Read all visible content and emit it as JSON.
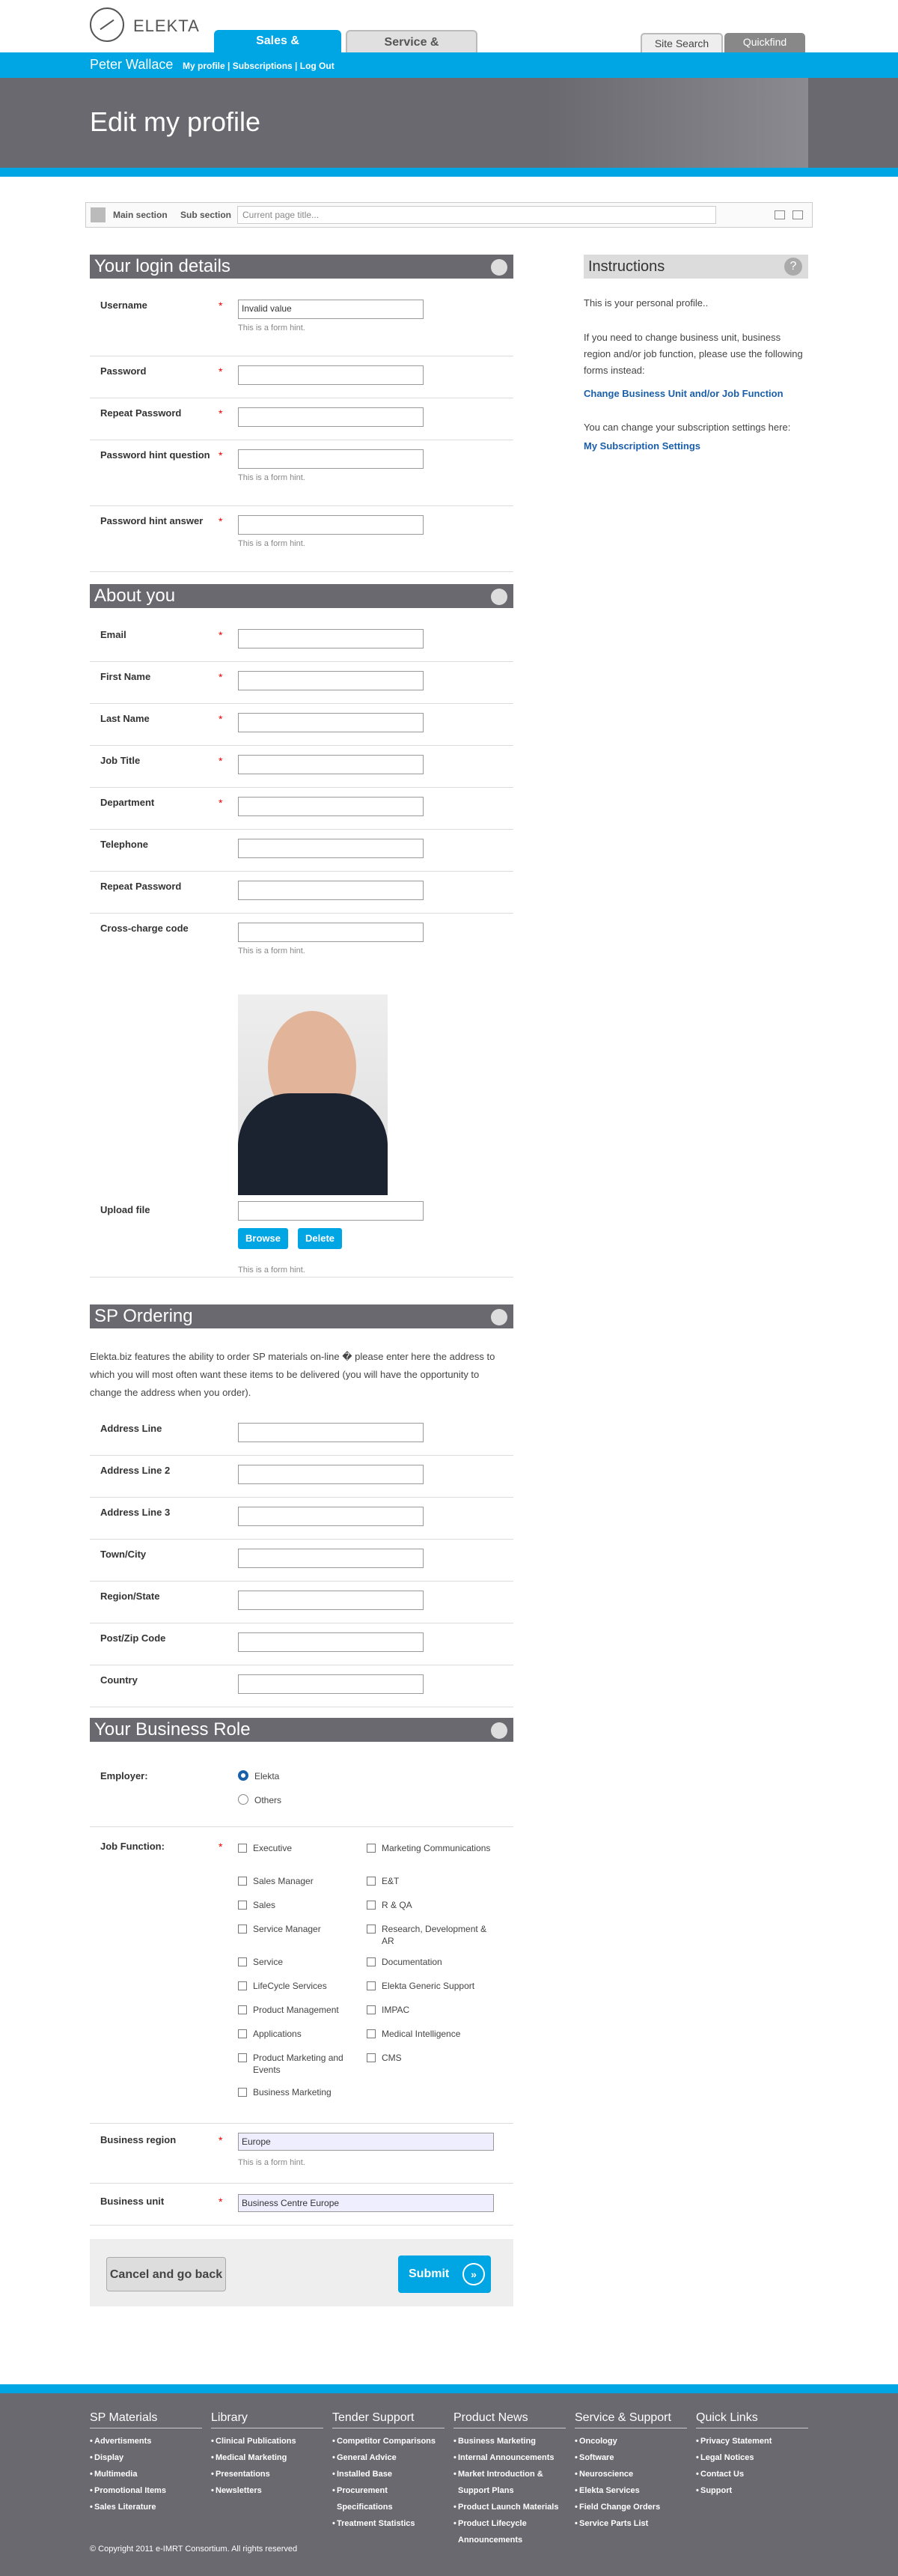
{
  "brand": {
    "logo_text": "ELEKTA"
  },
  "tabs": {
    "sales": "Sales & Marketing",
    "support": "Service & Support"
  },
  "utility": {
    "search": "Site Search",
    "quickfind": "Quickfind"
  },
  "user": {
    "name": "Peter Wallace",
    "links": "My profile | Subscriptions | Log Out"
  },
  "hero": {
    "title": "Edit my profile"
  },
  "breadcrumb": {
    "main": "Main section",
    "sub": "Sub section",
    "placeholder": "Current page title..."
  },
  "login": {
    "title": "Your login details",
    "username": {
      "label": "Username",
      "value": "Invalid value",
      "hint": "This is a form hint."
    },
    "password": {
      "label": "Password"
    },
    "repeat": {
      "label": "Repeat Password"
    },
    "question": {
      "label": "Password hint question",
      "hint": "This is a form hint."
    },
    "answer": {
      "label": "Password hint answer",
      "hint": "This is a form hint."
    }
  },
  "about": {
    "title": "About you",
    "email": "Email",
    "first": "First Name",
    "last": "Last Name",
    "job": "Job Title",
    "dept": "Department",
    "tel": "Telephone",
    "repeat": "Repeat Password",
    "charge": "Cross-charge code",
    "charge_hint": "This is a form hint.",
    "upload": "Upload file",
    "browse": "Browse",
    "delete": "Delete",
    "upload_hint": "This is a form hint."
  },
  "instructions": {
    "title": "Instructions",
    "help": "?",
    "p1": "This is your personal profile..",
    "p2": "If you need to change business unit, business region and/or job function, please use the following forms instead:",
    "link1": "Change Business Unit and/or Job Function",
    "p3": "You can change your subscription settings here:",
    "link2": "My Subscription Settings"
  },
  "sp": {
    "title": "SP Ordering",
    "para": "Elekta.biz features the ability to order SP materials on-line � please enter here the address to which you will most often want these items to be delivered (you will have the opportunity to change the address when you order).",
    "a1": "Address Line",
    "a2": "Address Line 2",
    "a3": "Address Line 3",
    "town": "Town/City",
    "region": "Region/State",
    "zip": "Post/Zip Code",
    "country": "Country"
  },
  "role": {
    "title": "Your Business Role",
    "employer": "Employer:",
    "elekta": "Elekta",
    "others": "Others",
    "job": "Job Function:",
    "left": [
      "Executive",
      "Sales Manager",
      "Sales",
      "Service Manager",
      "Service",
      "LifeCycle Services",
      "Product Management",
      "Applications",
      "Product Marketing and Events",
      "Business Marketing"
    ],
    "right": [
      "Marketing Communications",
      "E&T",
      "R & QA",
      "Research, Development & AR",
      "Documentation",
      "Elekta Generic Support",
      "IMPAC",
      "Medical Intelligence",
      "CMS"
    ],
    "region_label": "Business region",
    "region_value": "Europe",
    "region_hint": "This is a form hint.",
    "unit_label": "Business unit",
    "unit_value": "Business Centre Europe"
  },
  "actions": {
    "cancel": "Cancel and go back",
    "submit": "Submit",
    "submit_icon": "»"
  },
  "footer": {
    "cols": [
      {
        "h": "SP Materials",
        "items": [
          "Advertisments",
          "Display",
          "Multimedia",
          "Promotional Items",
          "Sales Literature"
        ]
      },
      {
        "h": "Library",
        "items": [
          "Clinical Publications",
          "Medical Marketing",
          "Presentations",
          "Newsletters"
        ]
      },
      {
        "h": "Tender Support",
        "items": [
          "Competitor Comparisons",
          "General Advice",
          "Installed Base",
          "Procurement Specifications",
          "Treatment Statistics"
        ]
      },
      {
        "h": "Product News",
        "items": [
          "Business Marketing",
          "Internal Announcements",
          "Market Introduction & Support Plans",
          "Product Launch Materials",
          "Product Lifecycle Announcements"
        ]
      },
      {
        "h": "Service & Support",
        "items": [
          "Oncology",
          "Software",
          "Neuroscience",
          "Elekta Services",
          "Field Change Orders",
          "Service Parts List"
        ]
      },
      {
        "h": "Quick Links",
        "items": [
          "Privacy Statement",
          "Legal Notices",
          "Contact Us",
          "Support"
        ]
      }
    ],
    "copyright": "© Copyright 2011 e-IMRT Consortium. All rights reserved"
  }
}
